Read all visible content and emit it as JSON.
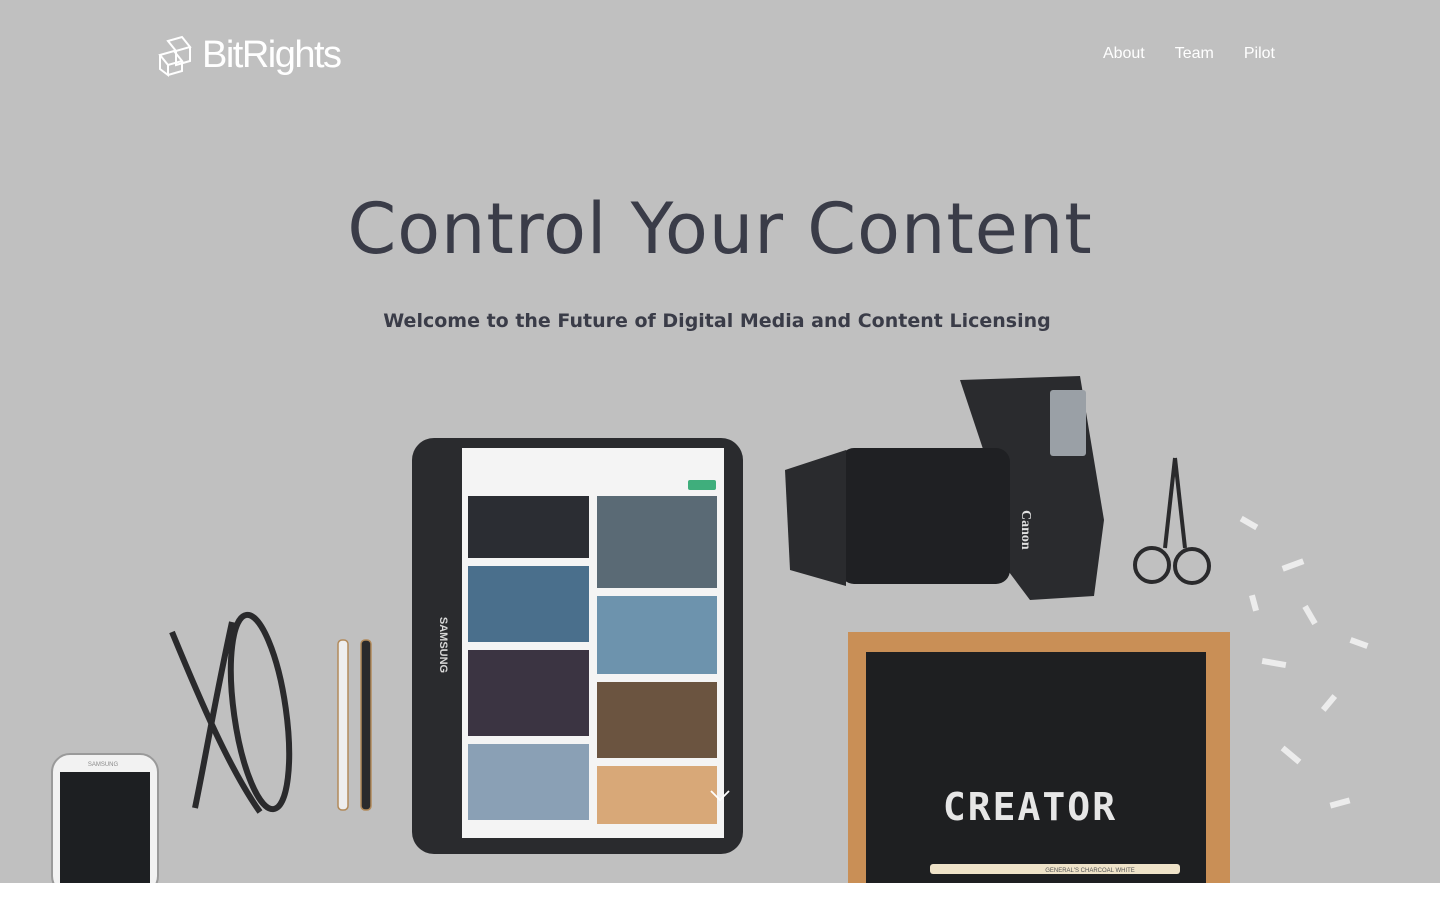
{
  "brand": {
    "name": "BitRights",
    "logo_icon": "cube-outline-logo"
  },
  "nav": {
    "items": [
      "About",
      "Team",
      "Pilot"
    ]
  },
  "hero": {
    "title": "Control Your Content",
    "subtitle": "Welcome to the Future of Digital Media and Content Licensing",
    "scroll_icon": "chevron-down-icon",
    "background_color": "#c0c0c0",
    "text_color": "#3a3c48"
  },
  "photo": {
    "tablet_brand": "SAMSUNG",
    "phone_brand": "SAMSUNG",
    "camera_brand": "Canon",
    "letterboard_text": "CREATOR",
    "pencil_text": "GENERAL'S CHARCOAL WHITE"
  }
}
